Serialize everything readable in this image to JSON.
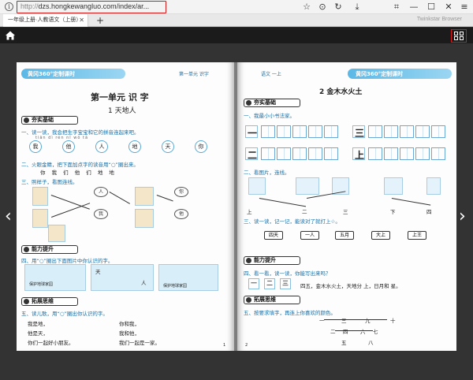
{
  "browser": {
    "url_protocol": "http://",
    "url_rest": "dzs.hongkewangluo.com/index/ar...",
    "tab_title": "一年级上册·人教语文（上册）",
    "tab_brand": "Twinkstar Browser"
  },
  "left_page": {
    "header_title": "黄冈360°定制课时",
    "header_sub": "第一单元  识字",
    "unit_title": "第一单元    识  字",
    "lesson_title": "1    天地人",
    "section1": "夯实基础",
    "q1": "一、读一读，我会把生字宝宝和它的拼音连起来吧。",
    "q1_pinyin": "tiān   dì   rén   nǐ   wǒ   tā",
    "q1_chars": [
      "我",
      "他",
      "人",
      "地",
      "天",
      "你"
    ],
    "q2": "二、火眼金睛，把下面加点字的读音用“○”圈出来。",
    "q2_line": "你    我 们    他 们    地 地",
    "q3": "三、照样子，看图连线。",
    "q3_chars": [
      "人",
      "你",
      "我",
      "他"
    ],
    "section2": "能力提升",
    "q4": "四、用“○”圈出下面图片中你认识的字。",
    "q4_captions": [
      "保护地球家园",
      "天",
      "人",
      "保护地球家园"
    ],
    "section3": "拓展思维",
    "q5": "五、读儿歌，用“○”圈出你认识的字。",
    "poem_left": [
      "我是地，",
      "他是天，",
      "你们一起好小朋友。"
    ],
    "poem_right": [
      "你和我，",
      "我和他，",
      "我们一起是一家。"
    ],
    "page_num": "1"
  },
  "right_page": {
    "header_title": "黄冈360°定制课时",
    "header_sub": "语文  一上",
    "lesson_title": "2    金木水火土",
    "section1": "夯实基础",
    "q1": "一、我最小小书法家。",
    "grid_chars": [
      "一",
      "二",
      "三",
      "上"
    ],
    "q2": "二、看图片，连线。",
    "q2_labels": [
      "上",
      "二",
      "三",
      "下",
      "四"
    ],
    "q3": "三、读一读，记一记，能读对了就打上☆。",
    "q3_tags": [
      "四天",
      "一人",
      "五月",
      "大上",
      "上王"
    ],
    "section2": "能力提升",
    "q4": "四、看一看，读一读，你能写出来吗？",
    "q4_text": "四五，金木水火土，天地分   上，日月和   星。",
    "q4_small": [
      "一",
      "二",
      "三"
    ],
    "section3": "拓展思维",
    "q5": "五、按要求填字，再连上你喜欢的颜色。",
    "tree_chars": [
      "一",
      "三",
      "九",
      "十",
      "二",
      "四",
      "六",
      "七",
      "五",
      "八"
    ],
    "page_num": "2"
  }
}
